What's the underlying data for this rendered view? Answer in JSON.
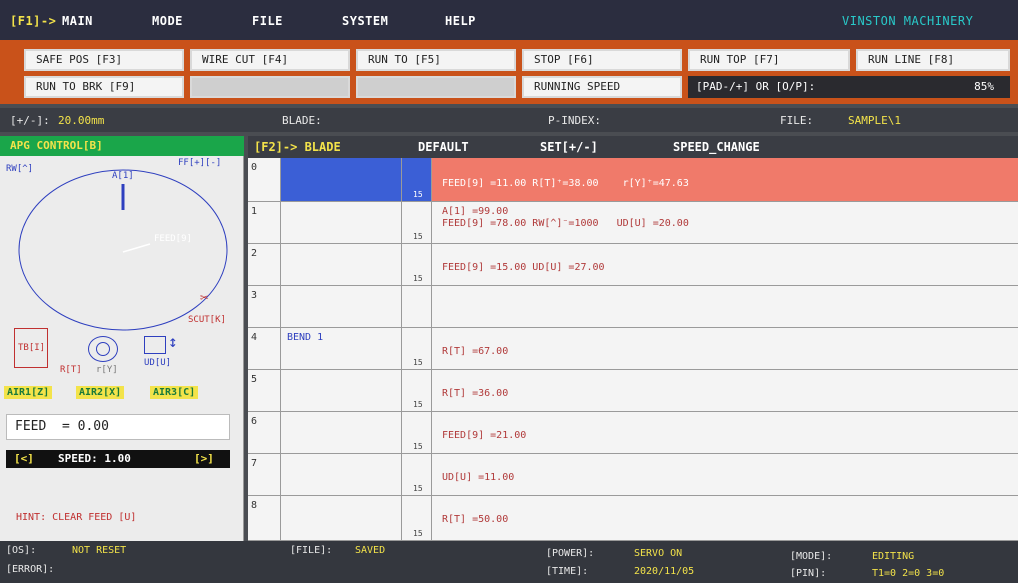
{
  "menu": {
    "f1": "[F1]->",
    "main": "MAIN",
    "mode": "MODE",
    "file": "FILE",
    "system": "SYSTEM",
    "help": "HELP",
    "brand": "VINSTON MACHINERY"
  },
  "buttons": {
    "safe_pos": "SAFE POS [F3]",
    "wire_cut": "WIRE CUT [F4]",
    "run_to": "RUN TO [F5]",
    "stop": "STOP [F6]",
    "run_top": "RUN TOP [F7]",
    "run_line": "RUN LINE [F8]",
    "run_to_brk": "RUN TO BRK [F9]",
    "running_speed": "RUNNING SPEED",
    "speed_hint": "[PAD-/+] OR [O/P]:",
    "speed_value": "85%"
  },
  "infobar": {
    "step_label": "[+/-]:",
    "step_value": "20.00mm",
    "blade_label": "BLADE:",
    "pindex_label": "P-INDEX:",
    "file_label": "FILE:",
    "file_value": "SAMPLE\\1"
  },
  "apg": {
    "title": "APG CONTROL[B]",
    "rw": "RW[^]",
    "ff": "FF[+][-]",
    "a1": "A[1]",
    "feed9": "FEED[9]",
    "scut": "SCUT[K]",
    "tb": "TB[I]",
    "r_t": "R[T]",
    "r_y": "r[Y]",
    "ud": "UD[U]",
    "air1": "AIR1[Z]",
    "air2": "AIR2[X]",
    "air3": "AIR3[C]",
    "feed_display": "FEED  = 0.00",
    "speed_left": "[<]",
    "speed_text": "SPEED: 1.00",
    "speed_right": "[>]",
    "hint": "HINT: CLEAR FEED [U]"
  },
  "table_header": {
    "f2": "[F2]-> BLADE",
    "default": "DEFAULT",
    "set": "SET[+/-]",
    "speed_change": "SPEED_CHANGE"
  },
  "rows": [
    {
      "idx": "0",
      "name": "",
      "spd": "15",
      "line1": "",
      "line2": "FEED[9] =11.00 R[T]⁺=38.00    r[Y]⁺=47.63"
    },
    {
      "idx": "1",
      "name": "",
      "spd": "15",
      "line1": "A[1] =99.00",
      "line2": "FEED[9] =78.00 RW[^]⁻=1000   UD[U] =20.00"
    },
    {
      "idx": "2",
      "name": "",
      "spd": "15",
      "line1": "",
      "line2": "FEED[9] =15.00 UD[U] =27.00"
    },
    {
      "idx": "3",
      "name": "",
      "spd": "",
      "line1": "",
      "line2": ""
    },
    {
      "idx": "4",
      "name": "BEND 1",
      "spd": "15",
      "line1": "",
      "line2": "R[T] =67.00"
    },
    {
      "idx": "5",
      "name": "",
      "spd": "15",
      "line1": "",
      "line2": "R[T] =36.00"
    },
    {
      "idx": "6",
      "name": "",
      "spd": "15",
      "line1": "",
      "line2": "FEED[9] =21.00"
    },
    {
      "idx": "7",
      "name": "",
      "spd": "15",
      "line1": "",
      "line2": "UD[U] =11.00"
    },
    {
      "idx": "8",
      "name": "",
      "spd": "15",
      "line1": "",
      "line2": "R[T] =50.00"
    }
  ],
  "status": {
    "os_label": "[OS]:",
    "os_value": "NOT RESET",
    "error_label": "[ERROR]:",
    "file_label": "[FILE]:",
    "file_value": "SAVED",
    "power_label": "[POWER]:",
    "power_value": "SERVO ON",
    "time_label": "[TIME]:",
    "time_value": "2020/11/05",
    "mode_label": "[MODE]:",
    "mode_value": "EDITING",
    "pin_label": "[PIN]:",
    "pin_value": "T1=0 2=0 3=0"
  },
  "colors": {
    "accent_orange": "#c9521a",
    "active_row": "#f07a6a",
    "green_header": "#1aa64a",
    "yellow": "#f3e34a"
  }
}
